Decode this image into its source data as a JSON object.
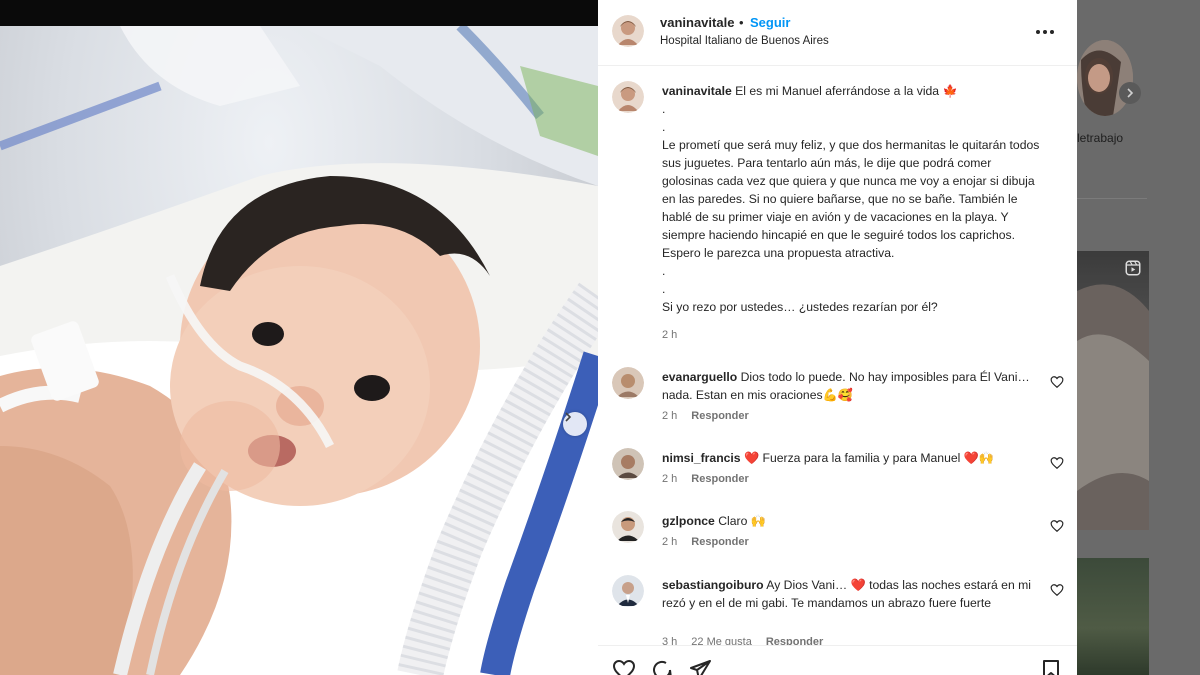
{
  "post": {
    "username": "vaninavitale",
    "dot": "•",
    "follow_label": "Seguir",
    "location": "Hospital Italiano de Buenos Aires",
    "more_icon": "more-horizontal-icon"
  },
  "caption": {
    "username": "vaninavitale",
    "line1": "El es mi Manuel aferrándose a la vida 🍁",
    "dot1": ".",
    "dot2": ".",
    "para": "Le prometí que será muy feliz, y que dos hermanitas le quitarán todos sus juguetes. Para tentarlo aún más, le dije que podrá comer golosinas cada vez que quiera y que nunca me voy a enojar si dibuja en las paredes. Si no quiere bañarse, que no se bañe. También le hablé de su primer viaje en avión y de vacaciones en la playa. Y siempre haciendo hincapié en que le seguiré todos los caprichos. Espero le parezca una propuesta atractiva.",
    "dot3": ".",
    "dot4": ".",
    "closing": "Si yo rezo por ustedes… ¿ustedes rezarían por él?",
    "time": "2 h"
  },
  "comments": [
    {
      "username": "evanarguello",
      "text": "Dios todo lo puede. No hay imposibles para Él Vani…nada. Estan en mis oraciones💪🥰",
      "time": "2 h",
      "reply": "Responder"
    },
    {
      "username": "nimsi_francis",
      "text": "❤️ Fuerza para la familia y para Manuel ❤️🙌",
      "time": "2 h",
      "reply": "Responder"
    },
    {
      "username": "gzlponce",
      "text": "Claro 🙌",
      "time": "2 h",
      "reply": "Responder"
    },
    {
      "username": "sebastiangoiburo",
      "text": "Ay Dios Vani… ❤️ todas las noches estará en mi rezó y en el de mi gabi. Te mandamos un abrazo fuere fuerte",
      "time": "3 h",
      "likes": "22 Me gusta",
      "reply": "Responder"
    }
  ],
  "actions": {
    "like_icon": "heart-icon",
    "comment_icon": "comment-icon",
    "share_icon": "send-icon",
    "save_icon": "bookmark-icon"
  },
  "sidebar": {
    "profile_name": "letrabajo"
  },
  "colors": {
    "follow_blue": "#0095f6",
    "text": "#262626",
    "muted": "#737373"
  }
}
